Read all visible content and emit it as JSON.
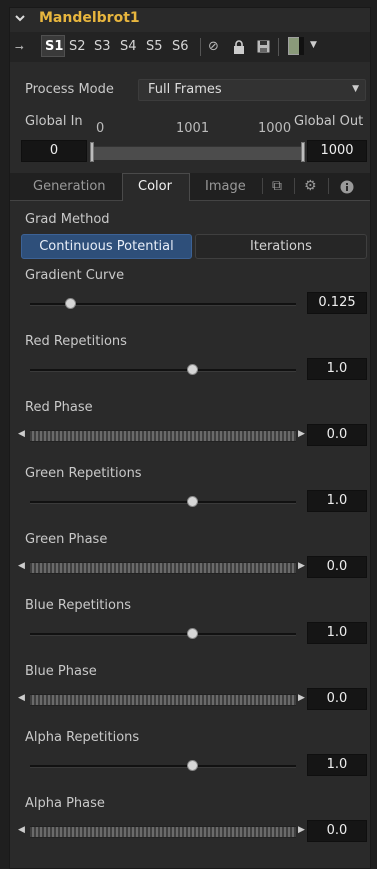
{
  "node": {
    "title": "Mandelbrot1"
  },
  "toolbar": {
    "slots": [
      "S1",
      "S2",
      "S3",
      "S4",
      "S5",
      "S6"
    ],
    "active_slot": "S1",
    "swatch_color": "#8a9a7a"
  },
  "process_mode": {
    "label": "Process Mode",
    "value": "Full Frames"
  },
  "global_range": {
    "in_label": "Global In",
    "out_label": "Global Out",
    "in_value": "0",
    "out_value": "1000",
    "tick_start": "0",
    "tick_mid": "1001",
    "tick_end": "1000"
  },
  "tabs": [
    {
      "label": "Generation",
      "active": false
    },
    {
      "label": "Color",
      "active": true
    },
    {
      "label": "Image",
      "active": false
    }
  ],
  "tab_icons": [
    "link-icon",
    "gear-icon",
    "info-icon"
  ],
  "grad_method": {
    "label": "Grad Method",
    "options": [
      "Continuous Potential",
      "Iterations"
    ],
    "selected": "Continuous Potential"
  },
  "controls": [
    {
      "label": "Gradient Curve",
      "kind": "slider",
      "value": "0.125",
      "level": 0.15
    },
    {
      "label": "Red Repetitions",
      "kind": "slider",
      "value": "1.0",
      "level": 0.61
    },
    {
      "label": "Red Phase",
      "kind": "thumbwheel",
      "value": "0.0"
    },
    {
      "label": "Green Repetitions",
      "kind": "slider",
      "value": "1.0",
      "level": 0.61
    },
    {
      "label": "Green Phase",
      "kind": "thumbwheel",
      "value": "0.0"
    },
    {
      "label": "Blue Repetitions",
      "kind": "slider",
      "value": "1.0",
      "level": 0.61
    },
    {
      "label": "Blue Phase",
      "kind": "thumbwheel",
      "value": "0.0"
    },
    {
      "label": "Alpha Repetitions",
      "kind": "slider",
      "value": "1.0",
      "level": 0.61
    },
    {
      "label": "Alpha Phase",
      "kind": "thumbwheel",
      "value": "0.0"
    }
  ],
  "colors": {
    "title": "#e8b63e",
    "selected_button": "#2e4f7a",
    "panel": "#2a2a2a"
  }
}
